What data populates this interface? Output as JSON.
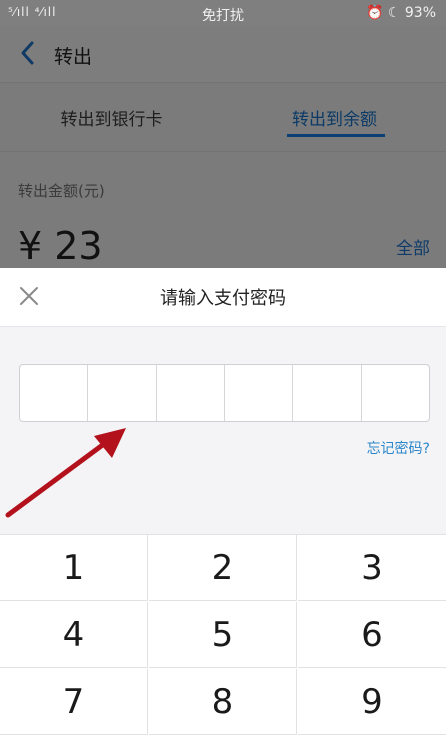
{
  "status_bar": {
    "signal_text": "⁵⁄ıll ⁴⁄ıll",
    "carrier_center": "免打扰",
    "battery": "93%",
    "status_icons": "⏰ ☾"
  },
  "nav": {
    "title": "转出"
  },
  "tabs": [
    {
      "label": "转出到银行卡",
      "active": false
    },
    {
      "label": "转出到余额",
      "active": true
    }
  ],
  "amount": {
    "label": "转出金额(元)",
    "value": "¥ 23",
    "all_link": "全部"
  },
  "password_sheet": {
    "title": "请输入支付密码",
    "forgot_link": "忘记密码?"
  },
  "keypad": {
    "keys": [
      "1",
      "2",
      "3",
      "4",
      "5",
      "6",
      "7",
      "8",
      "9"
    ]
  },
  "colors": {
    "accent_blue": "#2a86c9",
    "arrow_red": "#b3121c"
  }
}
